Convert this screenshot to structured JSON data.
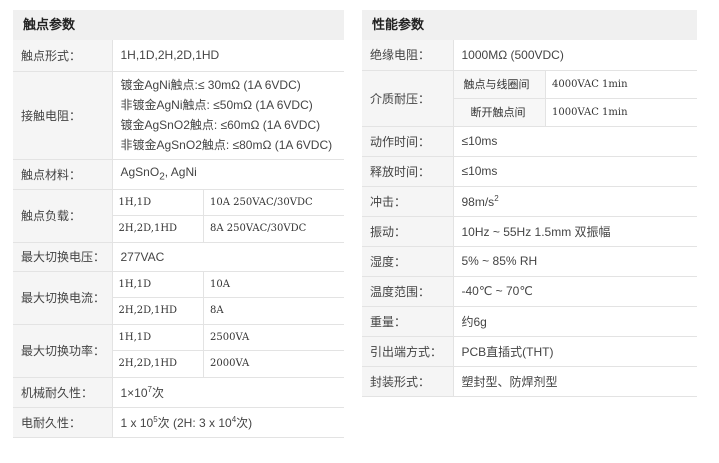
{
  "contact": {
    "title": "触点参数",
    "form_label": "触点形式：",
    "form_value": "1H,1D,2H,2D,1HD",
    "resistance_label": "接触电阻：",
    "resistance_lines": [
      "镀金AgNi触点:≤ 30mΩ (1A 6VDC)",
      "非镀金AgNi触点: ≤50mΩ (1A 6VDC)",
      "镀金AgSnO2触点: ≤60mΩ (1A 6VDC)",
      "非镀金AgSnO2触点: ≤80mΩ (1A 6VDC)"
    ],
    "material_label": "触点材料：",
    "material_prefix": "AgSnO",
    "material_sub": "2",
    "material_suffix": ", AgNi",
    "load_label": "触点负载：",
    "load_rows": [
      {
        "type": "1H,1D",
        "value": "10A 250VAC/30VDC"
      },
      {
        "type": "2H,2D,1HD",
        "value": "8A 250VAC/30VDC"
      }
    ],
    "max_voltage_label": "最大切换电压：",
    "max_voltage_value": "277VAC",
    "max_current_label": "最大切换电流：",
    "max_current_rows": [
      {
        "type": "1H,1D",
        "value": "10A"
      },
      {
        "type": "2H,2D,1HD",
        "value": "8A"
      }
    ],
    "max_power_label": "最大切换功率：",
    "max_power_rows": [
      {
        "type": "1H,1D",
        "value": "2500VA"
      },
      {
        "type": "2H,2D,1HD",
        "value": "2000VA"
      }
    ],
    "mech_life_label": "机械耐久性：",
    "mech_life_base": "1×10",
    "mech_life_exp": "7",
    "mech_life_unit": "次",
    "elec_life_label": "电耐久性：",
    "elec_life_a": "1 x 10",
    "elec_life_a_exp": "5",
    "elec_life_b": "次 (2H: 3 x 10",
    "elec_life_b_exp": "4",
    "elec_life_c": "次)"
  },
  "performance": {
    "title": "性能参数",
    "insulation_label": "绝缘电阻：",
    "insulation_value": "1000MΩ (500VDC)",
    "dielectric_label": "介质耐压：",
    "dielectric_rows": [
      {
        "type": "触点与线圈间",
        "value": "4000VAC 1min"
      },
      {
        "type": "断开触点间",
        "value": "1000VAC 1min"
      }
    ],
    "operate_label": "动作时间：",
    "operate_value": "≤10ms",
    "release_label": "释放时间：",
    "release_value": "≤10ms",
    "shock_label": "冲击：",
    "shock_value": "98m/s",
    "shock_exp": "2",
    "vibration_label": "振动：",
    "vibration_value": "10Hz ~ 55Hz 1.5mm 双振幅",
    "humidity_label": "湿度：",
    "humidity_value": "5% ~ 85% RH",
    "temperature_label": "温度范围：",
    "temperature_value": "-40℃ ~ 70℃",
    "weight_label": "重量：",
    "weight_value": "约6g",
    "terminal_label": "引出端方式：",
    "terminal_value": "PCB直插式(THT)",
    "package_label": "封装形式：",
    "package_value": "塑封型、防焊剂型"
  }
}
